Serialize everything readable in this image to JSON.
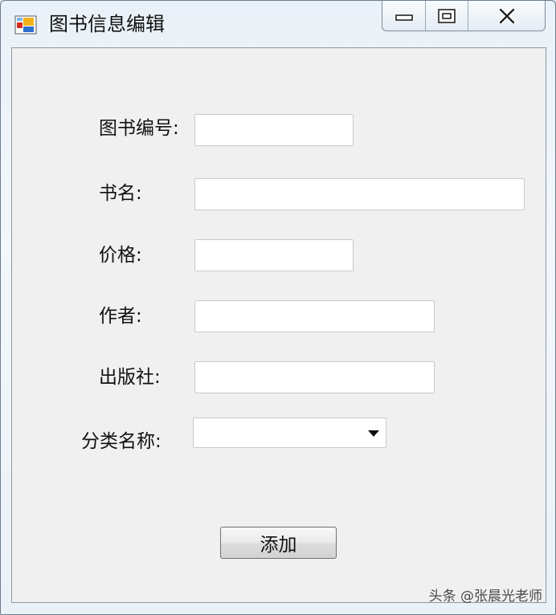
{
  "window": {
    "title": "图书信息编辑",
    "icon": "form-app-icon"
  },
  "caption_buttons": {
    "minimize_icon": "minimize-icon",
    "maximize_icon": "maximize-icon",
    "close_icon": "close-icon"
  },
  "form": {
    "book_id_label": "图书编号:",
    "book_id_value": "",
    "book_name_label": "书名:",
    "book_name_value": "",
    "price_label": "价格:",
    "price_value": "",
    "author_label": "作者:",
    "author_value": "",
    "publisher_label": "出版社:",
    "publisher_value": "",
    "category_label": "分类名称:",
    "category_value": "",
    "add_button_label": "添加"
  },
  "watermark": "头条 @张晨光老师",
  "colors": {
    "window_frame": "#e9f1f8",
    "client_background": "#f0f0f0",
    "input_background": "#ffffff",
    "input_border": "#c6c9cc"
  }
}
